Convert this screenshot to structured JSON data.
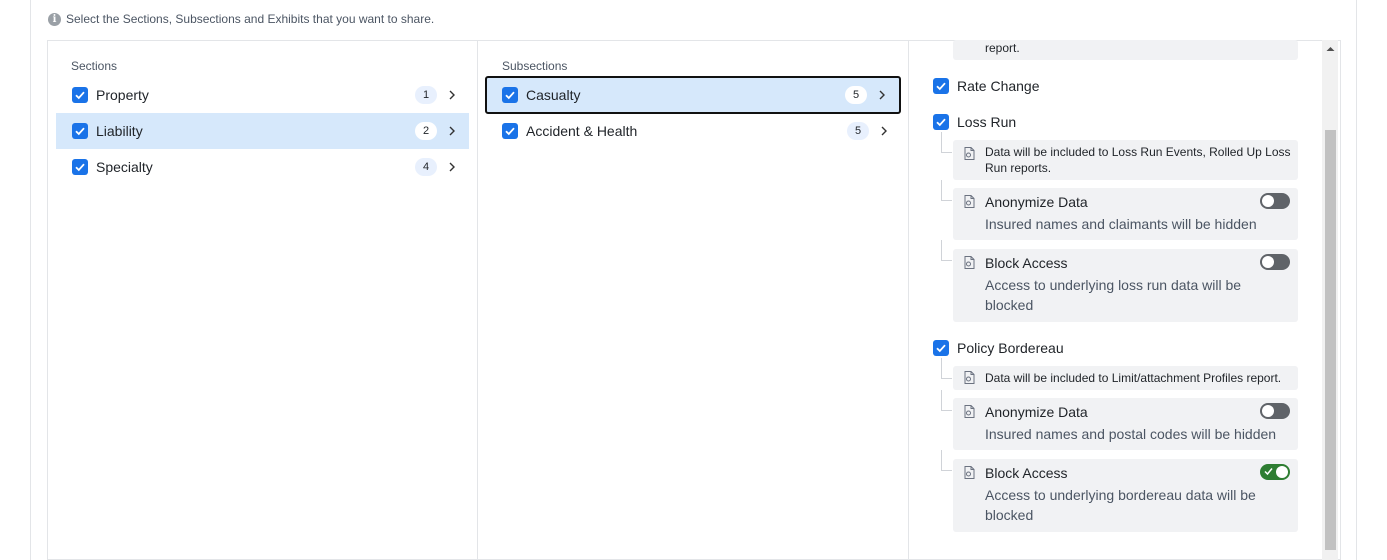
{
  "info": {
    "text": "Select the Sections, Subsections and Exhibits that you want to share."
  },
  "sections": {
    "title": "Sections",
    "items": [
      {
        "label": "Property",
        "count": "1"
      },
      {
        "label": "Liability",
        "count": "2"
      },
      {
        "label": "Specialty",
        "count": "4"
      }
    ]
  },
  "subsections": {
    "title": "Subsections",
    "items": [
      {
        "label": "Casualty",
        "count": "5"
      },
      {
        "label": "Accident & Health",
        "count": "5"
      }
    ]
  },
  "exhibits": {
    "top_partial_note": "report.",
    "rate_change": {
      "label": "Rate Change"
    },
    "loss_run": {
      "label": "Loss Run",
      "note_line1": "Data will be included to Loss Run Events, Rolled Up Loss",
      "note_line2": "Run reports.",
      "anonymize": {
        "title": "Anonymize Data",
        "desc": "Insured names and claimants will be hidden",
        "enabled": false
      },
      "block": {
        "title": "Block Access",
        "desc_line1": "Access to underlying loss run data will be",
        "desc_line2": "blocked",
        "enabled": false
      }
    },
    "policy_bordereau": {
      "label": "Policy Bordereau",
      "note": "Data will be included to Limit/attachment Profiles report.",
      "anonymize": {
        "title": "Anonymize Data",
        "desc": "Insured names and postal codes will be hidden",
        "enabled": false
      },
      "block": {
        "title": "Block Access",
        "desc_line1": "Access to underlying bordereau data will be",
        "desc_line2": "blocked",
        "enabled": true
      }
    }
  },
  "colors": {
    "accent": "#1a73e8",
    "selected_bg": "#d6e8fb",
    "toggle_on": "#2e7d32",
    "toggle_off": "#5f6368"
  }
}
